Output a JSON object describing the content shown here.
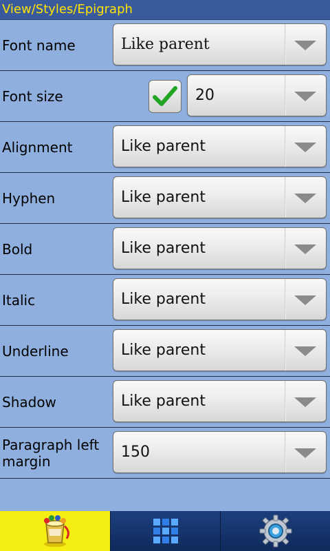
{
  "title": "View/Styles/Epigraph",
  "rows": [
    {
      "label": "Font name",
      "value": "Like parent"
    },
    {
      "label": "Font size",
      "value": "20",
      "checked": true
    },
    {
      "label": "Alignment",
      "value": "Like parent"
    },
    {
      "label": "Hyphen",
      "value": "Like parent"
    },
    {
      "label": "Bold",
      "value": "Like parent"
    },
    {
      "label": "Italic",
      "value": "Like parent"
    },
    {
      "label": "Underline",
      "value": "Like parent"
    },
    {
      "label": "Shadow",
      "value": "Like parent"
    },
    {
      "label": "Paragraph left margin",
      "value": "150"
    }
  ],
  "bottom_tabs": [
    {
      "icon": "paint-bucket-icon",
      "active": true
    },
    {
      "icon": "grid-icon",
      "active": false
    },
    {
      "icon": "gear-icon",
      "active": false
    }
  ],
  "colors": {
    "background": "#8fb0de",
    "title_bar": "#3a5a9e",
    "title_text": "#ffe400",
    "bottom_bar": "#1c3f7d",
    "active_tab": "#f5ee12",
    "checkmark": "#22a524"
  }
}
